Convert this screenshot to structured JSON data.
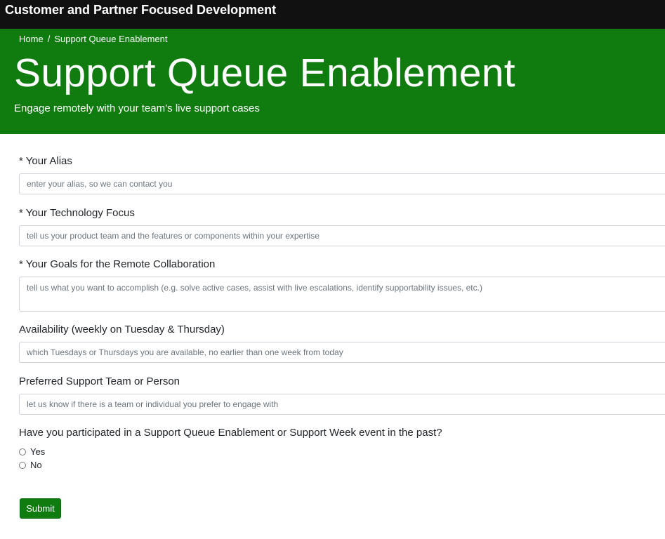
{
  "header": {
    "brand": "Customer and Partner Focused Development"
  },
  "hero": {
    "breadcrumb": {
      "home": "Home",
      "separator": "/",
      "current": "Support Queue Enablement"
    },
    "title": "Support Queue Enablement",
    "subtitle": "Engage remotely with your team’s live support cases",
    "background_color": "#107c10"
  },
  "form": {
    "alias": {
      "label": "* Your Alias",
      "placeholder": "enter your alias, so we can contact you",
      "value": ""
    },
    "technology": {
      "label": "* Your Technology Focus",
      "placeholder": "tell us your product team and the features or components within your expertise",
      "value": ""
    },
    "goals": {
      "label": "* Your Goals for the Remote Collaboration",
      "placeholder": "tell us what you want to accomplish (e.g. solve active cases, assist with live escalations, identify supportability issues, etc.)",
      "value": ""
    },
    "availability": {
      "label": "Availability (weekly on Tuesday & Thursday)",
      "placeholder": "which Tuesdays or Thursdays you are available, no earlier than one week from today",
      "value": ""
    },
    "preferred": {
      "label": "Preferred Support Team or Person",
      "placeholder": "let us know if there is a team or individual you prefer to engage with",
      "value": ""
    },
    "participated": {
      "question": "Have you participated in a Support Queue Enablement or Support Week event in the past?",
      "options": [
        "Yes",
        "No"
      ],
      "selected": null
    },
    "submit_label": "Submit"
  }
}
